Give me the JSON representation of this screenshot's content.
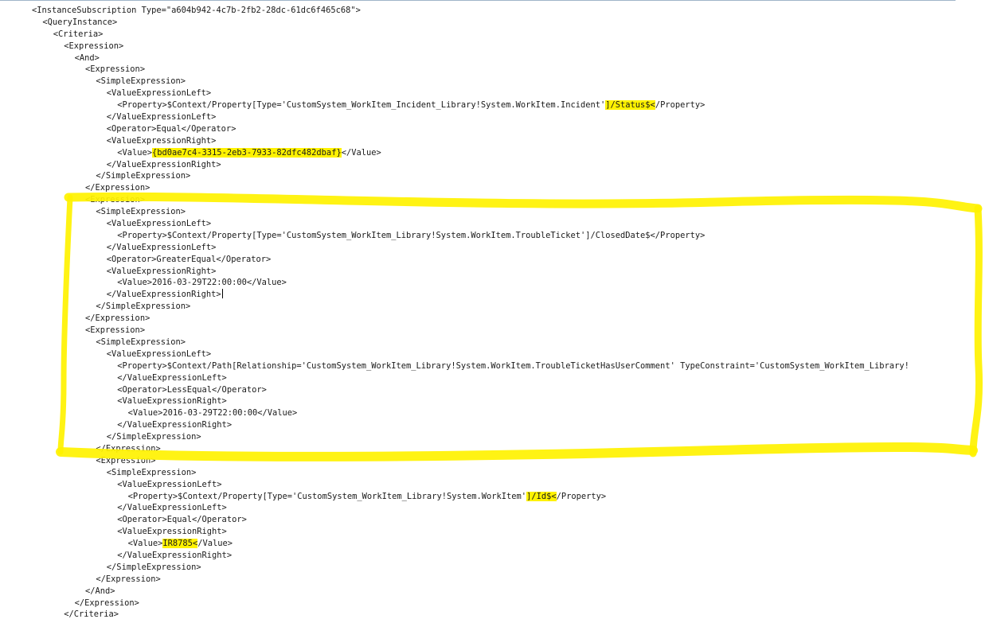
{
  "editor": {
    "highlight_color": "#fff200",
    "text_color": "#1a1a1a",
    "lines": [
      [
        {
          "t": "<InstanceSubscription Type=\"a604b942-4c7b-2fb2-28dc-61dc6f465c68\">"
        }
      ],
      [
        {
          "t": "<QueryInstance>"
        }
      ],
      [
        {
          "t": "<Criteria>"
        }
      ],
      [
        {
          "t": "<Expression>"
        }
      ],
      [
        {
          "t": "<And>"
        }
      ],
      [
        {
          "t": "<Expression>"
        }
      ],
      [
        {
          "t": "<SimpleExpression>"
        }
      ],
      [
        {
          "t": "<ValueExpressionLeft>"
        }
      ],
      [
        {
          "t": "<Property>$Context/Property[Type='CustomSystem_WorkItem_Incident_Library!System.WorkItem.Incident'"
        },
        {
          "t": "]/Status$<",
          "h": true
        },
        {
          "t": "/Property>"
        }
      ],
      [
        {
          "t": "</ValueExpressionLeft>"
        }
      ],
      [
        {
          "t": "<Operator>Equal</Operator>"
        }
      ],
      [
        {
          "t": "<ValueExpressionRight>"
        }
      ],
      [
        {
          "t": "<Value>"
        },
        {
          "t": "{bd0ae7c4-3315-2eb3-7933-82dfc482dbaf}",
          "h": true
        },
        {
          "t": "</Value>"
        }
      ],
      [
        {
          "t": "</ValueExpressionRight>"
        }
      ],
      [
        {
          "t": "</SimpleExpression>"
        }
      ],
      [
        {
          "t": "</Expression>"
        }
      ],
      [
        {
          "t": "<Expression>"
        }
      ],
      [
        {
          "t": "<SimpleExpression>"
        }
      ],
      [
        {
          "t": "<ValueExpressionLeft>"
        }
      ],
      [
        {
          "t": "<Property>$Context/Property[Type='CustomSystem_WorkItem_Library!System.WorkItem.TroubleTicket']/ClosedDate$</Property>"
        }
      ],
      [
        {
          "t": "</ValueExpressionLeft>"
        }
      ],
      [
        {
          "t": "<Operator>GreaterEqual</Operator>"
        }
      ],
      [
        {
          "t": "<ValueExpressionRight>"
        }
      ],
      [
        {
          "t": "<Value>2016-03-29T22:00:00</Value>"
        }
      ],
      [
        {
          "t": "</ValueExpressionRight>"
        },
        {
          "caret": true
        }
      ],
      [
        {
          "t": "</SimpleExpression>"
        }
      ],
      [
        {
          "t": "</Expression>"
        }
      ],
      [
        {
          "t": "<Expression>"
        }
      ],
      [
        {
          "t": "<SimpleExpression>"
        }
      ],
      [
        {
          "t": "<ValueExpressionLeft>"
        }
      ],
      [
        {
          "t": "<Property>$Context/Path[Relationship='CustomSystem_WorkItem_Library!System.WorkItem.TroubleTicketHasUserComment' TypeConstraint='CustomSystem_WorkItem_Library!"
        }
      ],
      [
        {
          "t": "</ValueExpressionLeft>"
        }
      ],
      [
        {
          "t": "<Operator>LessEqual</Operator>"
        }
      ],
      [
        {
          "t": "<ValueExpressionRight>"
        }
      ],
      [
        {
          "t": "<Value>2016-03-29T22:00:00</Value>"
        }
      ],
      [
        {
          "t": "</ValueExpressionRight>"
        }
      ],
      [
        {
          "t": "</SimpleExpression>"
        }
      ],
      [
        {
          "t": "</Expression>"
        }
      ],
      [
        {
          "t": "<Expression>"
        }
      ],
      [
        {
          "t": "<SimpleExpression>"
        }
      ],
      [
        {
          "t": "<ValueExpressionLeft>"
        }
      ],
      [
        {
          "t": "<Property>$Context/Property[Type='CustomSystem_WorkItem_Library!System.WorkItem'"
        },
        {
          "t": "]/Id$<",
          "h": true
        },
        {
          "t": "/Property>"
        }
      ],
      [
        {
          "t": "</ValueExpressionLeft>"
        }
      ],
      [
        {
          "t": "<Operator>Equal</Operator>"
        }
      ],
      [
        {
          "t": "<ValueExpressionRight>"
        }
      ],
      [
        {
          "t": "<Value>"
        },
        {
          "t": "IR8785<",
          "h": true
        },
        {
          "t": "/Value>"
        }
      ],
      [
        {
          "t": "</ValueExpressionRight>"
        }
      ],
      [
        {
          "t": "</SimpleExpression>"
        }
      ],
      [
        {
          "t": "</Expression>"
        }
      ],
      [
        {
          "t": "</And>"
        }
      ],
      [
        {
          "t": "</Expression>"
        }
      ],
      [
        {
          "t": "</Criteria>"
        }
      ]
    ]
  }
}
